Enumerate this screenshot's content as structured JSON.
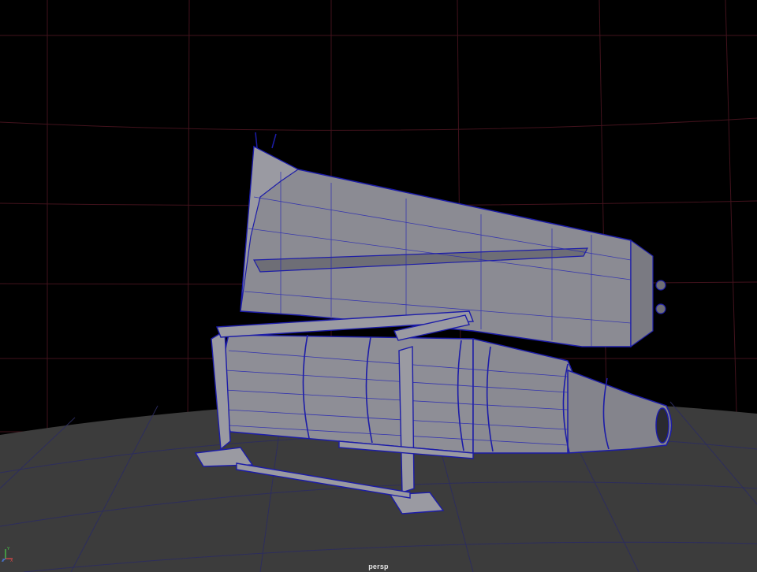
{
  "viewport": {
    "camera_name": "persp",
    "background_color": "#000000",
    "floor_color": "#3c3c3c",
    "grid_line_color": "#5a1a24",
    "floor_grid_color": "#2b2b55",
    "model_fill_color": "#8e8e96",
    "wireframe_color": "#1c1ca8"
  },
  "axis_gizmo": {
    "y_label": "Y",
    "x_label": "X",
    "z_label": "Z",
    "y_color": "#4ad34a",
    "x_color": "#e04848",
    "z_color": "#4a7ae0"
  }
}
